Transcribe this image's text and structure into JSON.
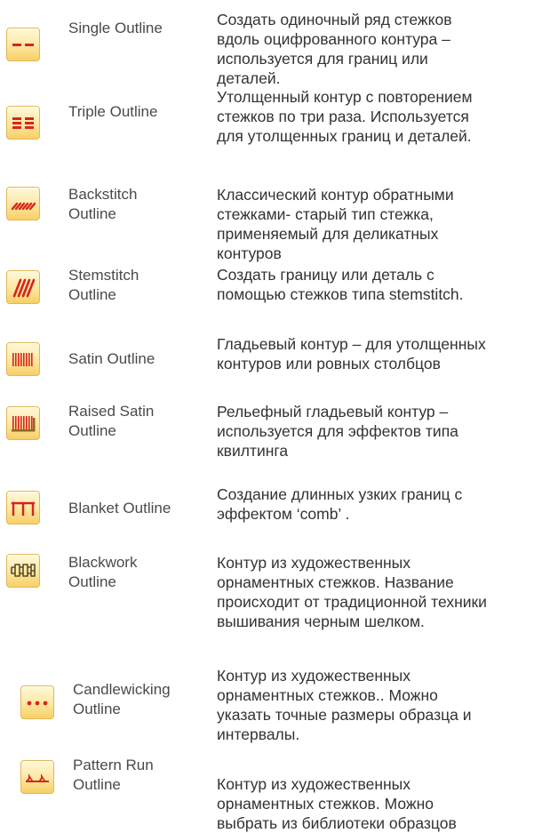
{
  "accent_color": "#d7251e",
  "items": [
    {
      "icon": "single-outline-icon",
      "label": [
        "Single Outline"
      ],
      "description": [
        "Создать одиночный ряд стежков",
        "вдоль оцифрованного контура –",
        "используется для границ или",
        "деталей."
      ]
    },
    {
      "icon": "triple-outline-icon",
      "label": [
        "Triple Outline"
      ],
      "description": [
        "Утолщенный контур с повторением",
        "стежков по три раза.  Используется",
        "для утолщенных границ и деталей."
      ]
    },
    {
      "icon": "backstitch-outline-icon",
      "label": [
        "Backstitch",
        "Outline"
      ],
      "description": [
        "Классический контур обратными",
        "стежками- старый тип стежка,",
        "применяемый для деликатных",
        "контуров"
      ]
    },
    {
      "icon": "stemstitch-outline-icon",
      "label": [
        "Stemstitch",
        "Outline"
      ],
      "description": [
        "Создать границу или деталь с",
        "помощью стежков типа stemstitch."
      ]
    },
    {
      "icon": "satin-outline-icon",
      "label": [
        "Satin Outline"
      ],
      "description": [
        "Гладьевый контур – для утолщенных",
        "контуров или ровных столбцов"
      ]
    },
    {
      "icon": "raised-satin-outline-icon",
      "label": [
        "Raised Satin",
        "Outline"
      ],
      "description": [
        "Рельефный гладьевый контур –",
        "используется для эффектов типа",
        "квилтинга"
      ]
    },
    {
      "icon": "blanket-outline-icon",
      "label": [
        "Blanket Outline"
      ],
      "description": [
        "Создание длинных узких границ с",
        "эффектом ‘comb’ ."
      ]
    },
    {
      "icon": "blackwork-outline-icon",
      "label": [
        "Blackwork",
        "Outline"
      ],
      "description": [
        "Контур из художественных",
        "орнаментных стежков. Название",
        "происходит от традиционной техники",
        "вышивания черным шелком."
      ]
    },
    {
      "icon": "candlewicking-outline-icon",
      "label": [
        "Candlewicking",
        "Outline"
      ],
      "description": [
        "Контур из художественных",
        "орнаментных стежков.. Можно",
        "указать точные размеры образца и",
        "интервалы."
      ]
    },
    {
      "icon": "pattern-run-outline-icon",
      "label": [
        "Pattern Run",
        "Outline"
      ],
      "description": [
        "Контур из художественных",
        "орнаментных стежков. Можно",
        "выбрать из библиотеки образцов"
      ]
    }
  ]
}
